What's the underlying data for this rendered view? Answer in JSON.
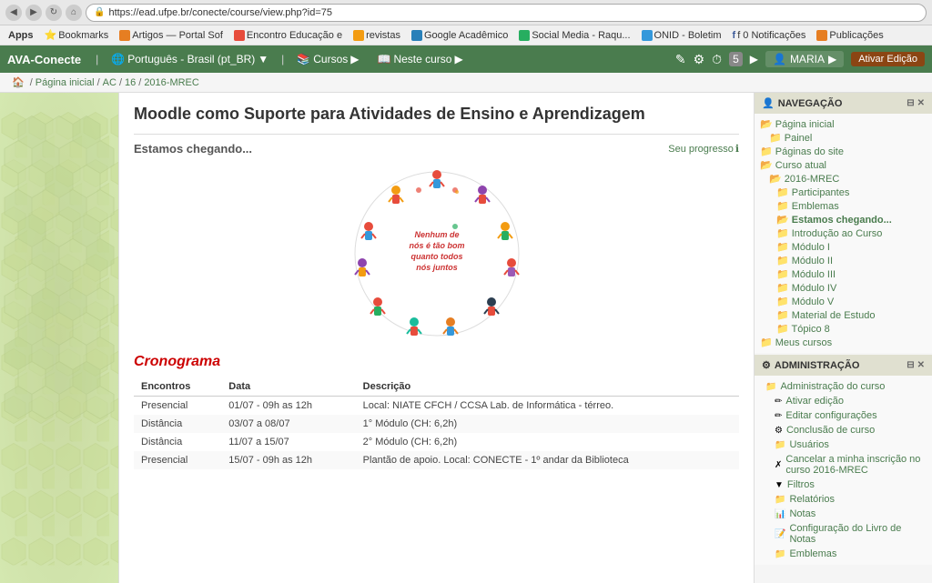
{
  "browser": {
    "url": "https://ead.ufpe.br/conecte/course/view.php?id=75",
    "back_btn": "◀",
    "forward_btn": "▶",
    "refresh_btn": "↻",
    "home_btn": "⌂"
  },
  "bookmarks": {
    "items": [
      {
        "label": "Apps",
        "type": "apps"
      },
      {
        "label": "Bookmarks",
        "type": "bookmarks",
        "color": "orange"
      },
      {
        "label": "Artigos — Portal Sof",
        "type": "link",
        "color": "orange"
      },
      {
        "label": "Encontro Educação e",
        "type": "link",
        "color": "red"
      },
      {
        "label": "revistas",
        "type": "link",
        "color": "yellow"
      },
      {
        "label": "Google Acadêmico",
        "type": "link",
        "color": "blue"
      },
      {
        "label": "Social Media - Raqu...",
        "type": "link",
        "color": "green"
      },
      {
        "label": "ONID - Boletim",
        "type": "link",
        "color": "blue"
      },
      {
        "label": "f 0 Notificações",
        "type": "link",
        "color": "blue2"
      },
      {
        "label": "Publicações",
        "type": "link",
        "color": "orange2"
      }
    ]
  },
  "topnav": {
    "brand": "AVA-Conecte",
    "language": "Português - Brasil (pt_BR)",
    "courses_label": "Cursos",
    "this_course_label": "Neste curso",
    "user_name": "MARIA",
    "edit_btn_label": "Ativar Edição",
    "icons": {
      "edit": "✎",
      "gear": "⚙",
      "clock": "⏱",
      "num": "5"
    }
  },
  "breadcrumb": {
    "items": [
      "Página inicial",
      "AC",
      "16",
      "2016-MREC"
    ]
  },
  "main": {
    "page_title": "Moodle como Suporte para Atividades de Ensino e Aprendizagem",
    "section_title": "Estamos chegando...",
    "progress_label": "Seu progresso",
    "circle_text": "Nenhum de nós é tão bom quanto todos nós juntos",
    "cronograma_title": "Cronograma",
    "table": {
      "headers": [
        "Encontros",
        "Data",
        "Descrição"
      ],
      "rows": [
        {
          "encontros": "Presencial",
          "data": "01/07 - 09h as 12h",
          "descricao": "Local: NIATE CFCH / CCSA Lab. de Informática - térreo."
        },
        {
          "encontros": "Distância",
          "data": "03/07 a 08/07",
          "descricao": "1° Módulo (CH: 6,2h)"
        },
        {
          "encontros": "Distância",
          "data": "11/07 a 15/07",
          "descricao": "2° Módulo (CH: 6,2h)"
        },
        {
          "encontros": "Presencial",
          "data": "15/07 - 09h as 12h",
          "descricao": "Plantão de apoio. Local: CONECTE - 1º andar da Biblioteca"
        }
      ]
    }
  },
  "sidebar": {
    "navigation": {
      "title": "NAVEGAÇÃO",
      "items": [
        {
          "label": "Página inicial",
          "indent": 0,
          "type": "folder-open"
        },
        {
          "label": "Painel",
          "indent": 1,
          "type": "folder"
        },
        {
          "label": "Páginas do site",
          "indent": 0,
          "type": "folder"
        },
        {
          "label": "Curso atual",
          "indent": 0,
          "type": "folder-open"
        },
        {
          "label": "2016-MREC",
          "indent": 1,
          "type": "folder-open"
        },
        {
          "label": "Participantes",
          "indent": 2,
          "type": "folder"
        },
        {
          "label": "Emblemas",
          "indent": 2,
          "type": "folder"
        },
        {
          "label": "Estamos chegando...",
          "indent": 2,
          "type": "folder-open",
          "current": true
        },
        {
          "label": "Introdução ao Curso",
          "indent": 2,
          "type": "folder"
        },
        {
          "label": "Módulo I",
          "indent": 2,
          "type": "folder"
        },
        {
          "label": "Módulo II",
          "indent": 2,
          "type": "folder"
        },
        {
          "label": "Módulo III",
          "indent": 2,
          "type": "folder"
        },
        {
          "label": "Módulo IV",
          "indent": 2,
          "type": "folder"
        },
        {
          "label": "Módulo V",
          "indent": 2,
          "type": "folder"
        },
        {
          "label": "Material de Estudo",
          "indent": 2,
          "type": "folder"
        },
        {
          "label": "Tópico 8",
          "indent": 2,
          "type": "folder"
        },
        {
          "label": "Meus cursos",
          "indent": 0,
          "type": "folder"
        }
      ]
    },
    "administration": {
      "title": "ADMINISTRAÇÃO",
      "items": [
        {
          "label": "Administração do curso",
          "indent": 0,
          "icon": "folder",
          "type": "folder-open"
        },
        {
          "label": "Ativar edição",
          "indent": 1,
          "icon": "pencil"
        },
        {
          "label": "Editar configurações",
          "indent": 1,
          "icon": "pencil"
        },
        {
          "label": "Conclusão de curso",
          "indent": 1,
          "icon": "gear"
        },
        {
          "label": "Usuários",
          "indent": 1,
          "icon": "folder"
        },
        {
          "label": "Cancelar a minha inscrição no curso 2016-MREC",
          "indent": 1,
          "icon": "cancel"
        },
        {
          "label": "Filtros",
          "indent": 1,
          "icon": "filter"
        },
        {
          "label": "Relatórios",
          "indent": 1,
          "icon": "folder"
        },
        {
          "label": "Notas",
          "indent": 1,
          "icon": "chart"
        },
        {
          "label": "Configuração do Livro de Notas",
          "indent": 1,
          "icon": "notes"
        },
        {
          "label": "Emblemas",
          "indent": 1,
          "icon": "folder"
        }
      ]
    }
  }
}
